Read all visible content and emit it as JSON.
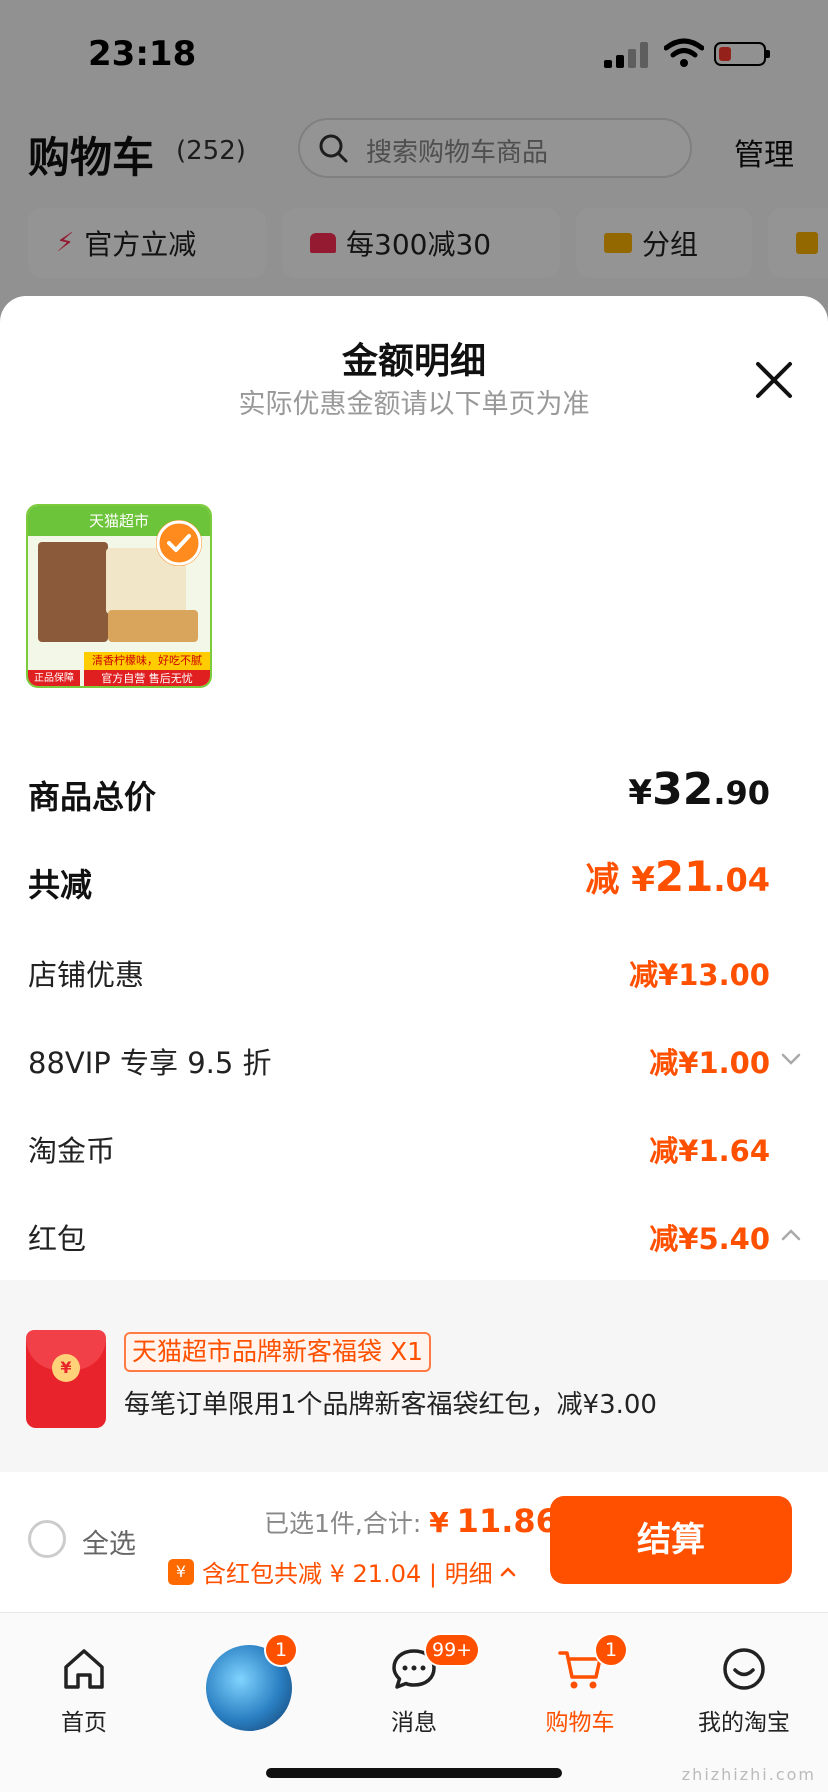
{
  "status_bar": {
    "time": "23:18"
  },
  "cart": {
    "title": "购物车",
    "count": "(252)",
    "search_placeholder": "搜索购物车商品",
    "manage": "管理",
    "chips": [
      {
        "label": "官方立减",
        "icon": "flash-icon"
      },
      {
        "label": "每300减30",
        "icon": "shop-icon"
      },
      {
        "label": "分组",
        "icon": "folder-icon"
      }
    ]
  },
  "sheet": {
    "title": "金额明细",
    "subtitle": "实际优惠金额请以下单页为准",
    "product": {
      "banner": "天猫超市",
      "strip1": "清香柠檬味，好吃不腻",
      "strip2": "官方自营 售后无忧",
      "tag": "正品保障"
    },
    "rows": {
      "total_label": "商品总价",
      "total_yen": "¥",
      "total_int": "32",
      "total_dec": ".90",
      "reduce_label": "共减",
      "reduce_prefix": "减 ¥",
      "reduce_int": "21",
      "reduce_dec": ".04",
      "shop_label": "店铺优惠",
      "shop_value": "减¥13.00",
      "vip_label": "88VIP 专享 9.5 折",
      "vip_value": "减¥1.00",
      "coin_label": "淘金币",
      "coin_value": "减¥1.64",
      "redpack_label": "红包",
      "redpack_value": "减¥5.40"
    },
    "coupon": {
      "tag": "天猫超市品牌新客福袋 X1",
      "desc": "每笔订单限用1个品牌新客福袋红包，减¥3.00"
    }
  },
  "footer": {
    "select_all": "全选",
    "selected": "已选1件,合计:",
    "total_yen": "¥",
    "total": "11.86",
    "discount": "含红包共减 ¥ 21.04 | 明细",
    "checkout": "结算"
  },
  "tabbar": {
    "home": "首页",
    "messages": "消息",
    "messages_badge": "99+",
    "cart": "购物车",
    "cart_badge": "1",
    "home_badge": "1",
    "mine": "我的淘宝"
  },
  "watermark": "zhizhizhi.com",
  "colors": {
    "accent": "#ff5000",
    "overlay": "rgba(0,0,0,0.42)"
  }
}
